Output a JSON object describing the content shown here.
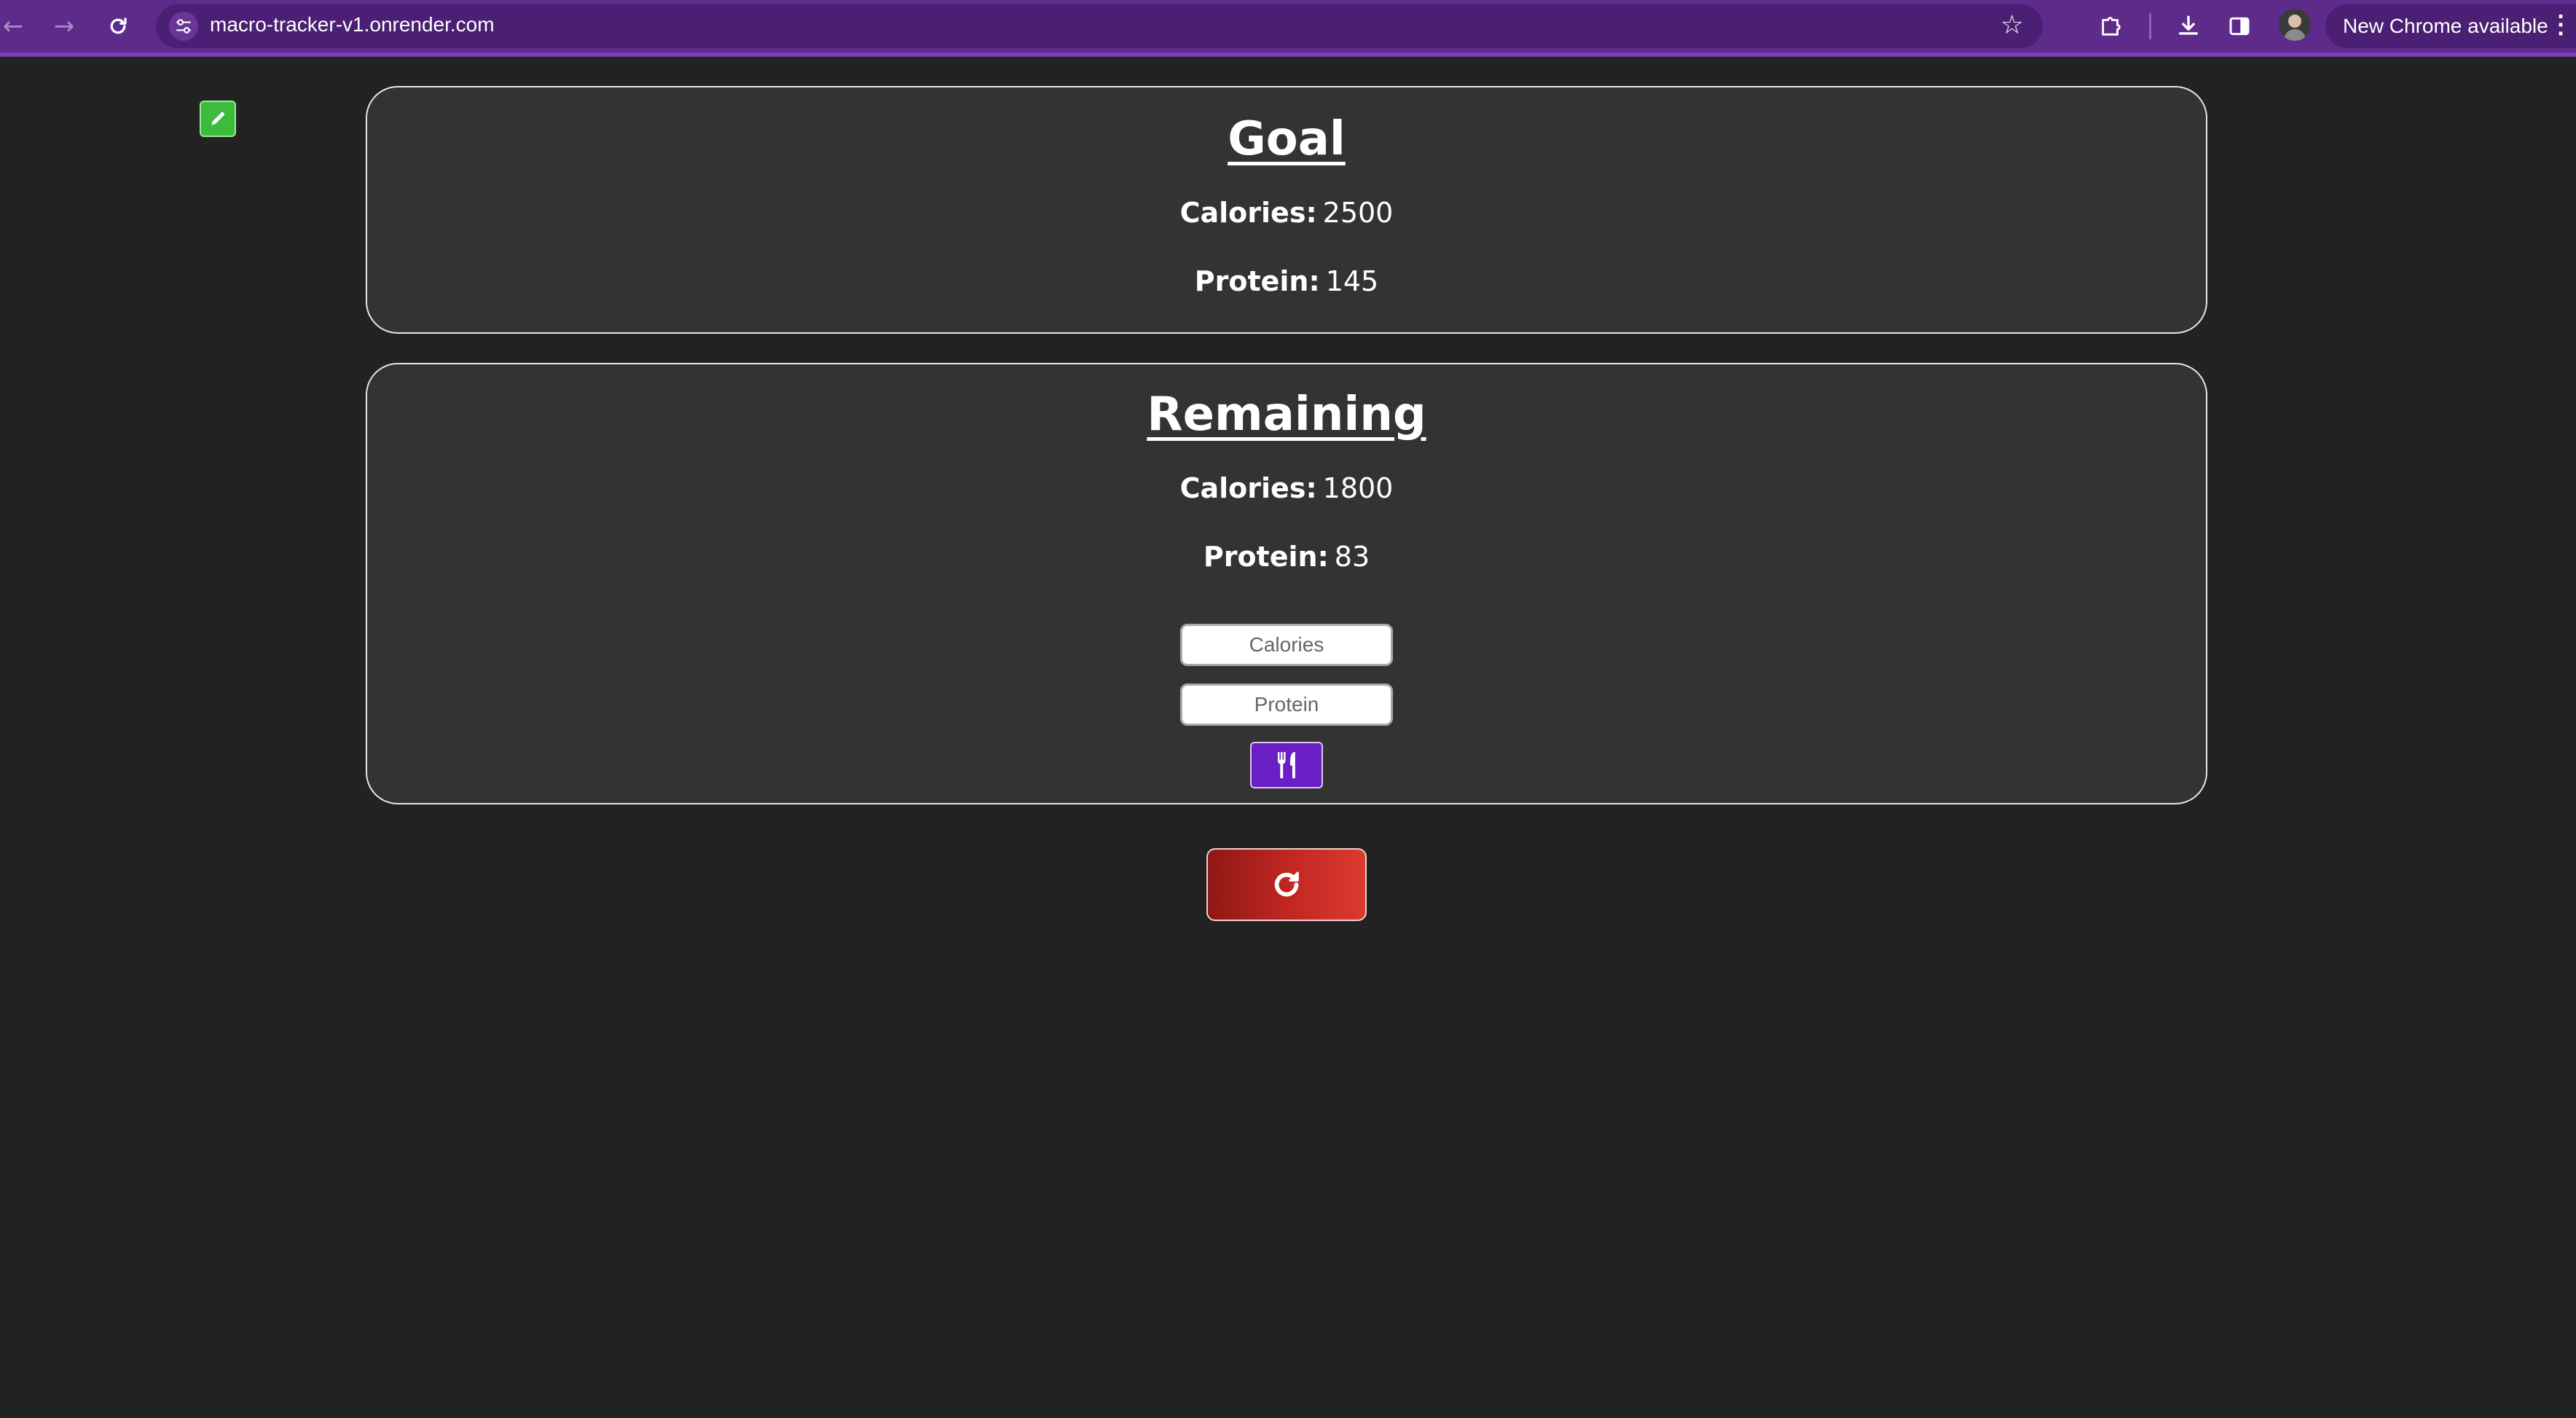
{
  "browser": {
    "url": "macro-tracker-v1.onrender.com",
    "update_label": "New Chrome available"
  },
  "goal": {
    "title": "Goal",
    "calories_label": "Calories:",
    "calories_value": "2500",
    "protein_label": "Protein:",
    "protein_value": "145"
  },
  "remaining": {
    "title": "Remaining",
    "calories_label": "Calories:",
    "calories_value": "1800",
    "protein_label": "Protein:",
    "protein_value": "83"
  },
  "form": {
    "calories_placeholder": "Calories",
    "protein_placeholder": "Protein"
  },
  "icons": {
    "edit": "pencil-icon",
    "eat": "fork-knife-icon",
    "reset": "refresh-icon"
  },
  "colors": {
    "chrome": "#5e2b8a",
    "background": "#222222",
    "card": "#333333",
    "edit_button": "#3cbb3c",
    "eat_button": "#6a1fc4",
    "reset_button": "#c42722"
  }
}
